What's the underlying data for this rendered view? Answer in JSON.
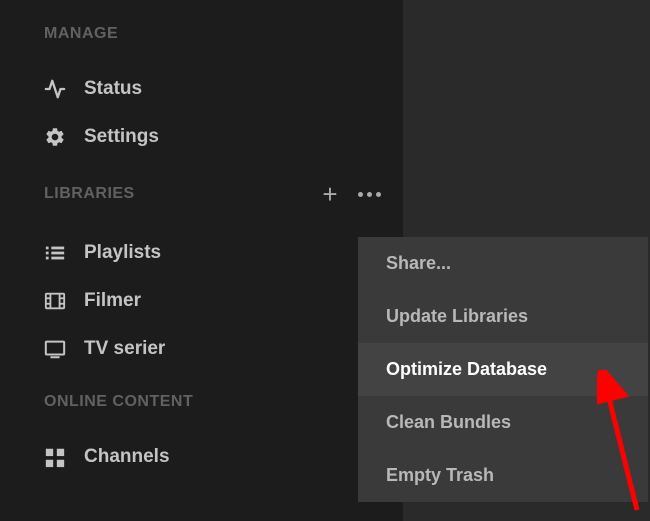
{
  "sidebar": {
    "sections": {
      "manage": {
        "label": "MANAGE",
        "items": [
          {
            "label": "Status"
          },
          {
            "label": "Settings"
          }
        ]
      },
      "libraries": {
        "label": "LIBRARIES",
        "items": [
          {
            "label": "Playlists"
          },
          {
            "label": "Filmer"
          },
          {
            "label": "TV serier"
          }
        ]
      },
      "online": {
        "label": "ONLINE CONTENT",
        "items": [
          {
            "label": "Channels"
          }
        ]
      }
    }
  },
  "dropdown": {
    "items": [
      {
        "label": "Share..."
      },
      {
        "label": "Update Libraries"
      },
      {
        "label": "Optimize Database"
      },
      {
        "label": "Clean Bundles"
      },
      {
        "label": "Empty Trash"
      }
    ]
  }
}
